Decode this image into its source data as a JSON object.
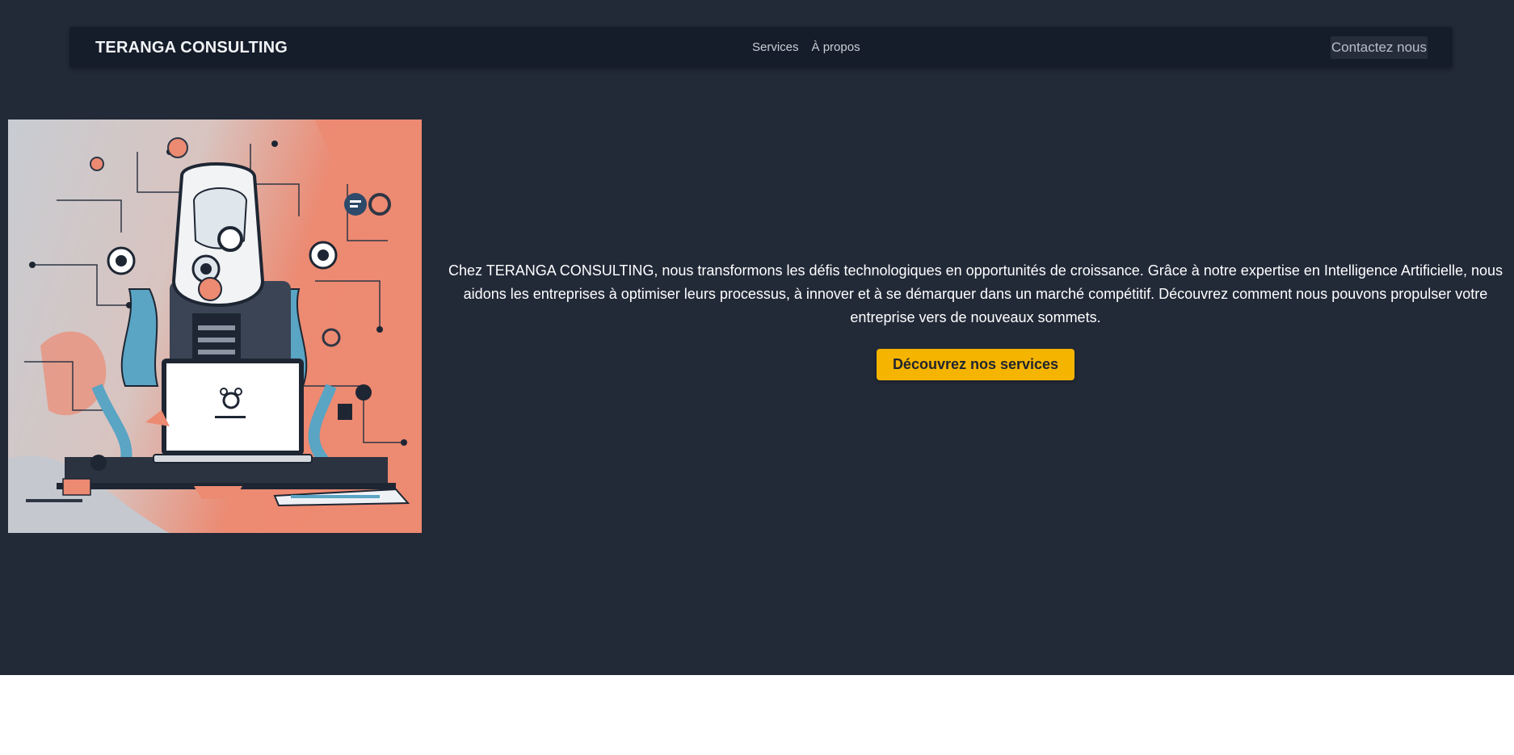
{
  "header": {
    "brand": "TERANGA CONSULTING",
    "nav": [
      {
        "label": "Services"
      },
      {
        "label": "À propos"
      }
    ],
    "contact_label": "Contactez nous"
  },
  "hero": {
    "image_icon": "robot-illustration",
    "text": "Chez TERANGA CONSULTING, nous transformons les défis technologiques en opportunités de croissance. Grâce à notre expertise en Intelligence Artificielle, nous aidons les entreprises à optimiser leurs processus, à innover et à se démarquer dans un marché compétitif. Découvrez comment nous pouvons propulser votre entreprise vers de nouveaux sommets.",
    "cta_label": "Découvrez nos services"
  },
  "colors": {
    "page_bg": "#222a38",
    "navbar_bg": "#161d2a",
    "accent": "#f5b400",
    "illustration_coral": "#ec8a72",
    "illustration_blue": "#5aa4c4"
  }
}
